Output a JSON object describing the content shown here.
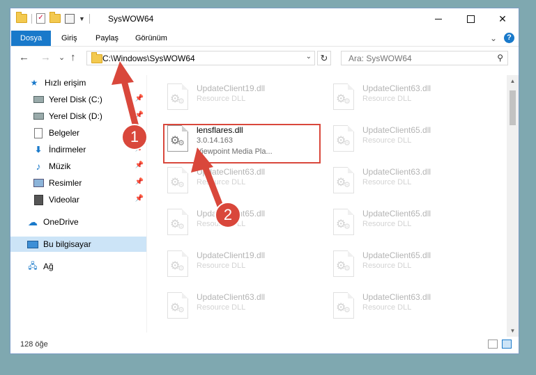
{
  "window": {
    "title": "SysWOW64",
    "controls": {
      "minimize": "—",
      "maximize": "",
      "close": "✕"
    }
  },
  "ribbon": {
    "tabs": [
      "Dosya",
      "Giriş",
      "Paylaş",
      "Görünüm"
    ],
    "expand_glyph": "⌄",
    "help": "?"
  },
  "nav": {
    "back": "←",
    "forward": "→",
    "recent": "⌄",
    "up": "↑",
    "address": "C:\\Windows\\SysWOW64",
    "address_dropdown": "⌄",
    "refresh": "↻",
    "search_placeholder": "Ara: SysWOW64",
    "search_glyph": "⚲"
  },
  "sidebar": {
    "quick_access": "Hızlı erişim",
    "items": [
      {
        "label": "Yerel Disk (C:)",
        "icon": "drive-icon",
        "pinned": true
      },
      {
        "label": "Yerel Disk (D:)",
        "icon": "drive-icon",
        "pinned": true
      },
      {
        "label": "Belgeler",
        "icon": "documents-icon",
        "pinned": true
      },
      {
        "label": "İndirmeler",
        "icon": "downloads-icon",
        "pinned": true
      },
      {
        "label": "Müzik",
        "icon": "music-icon",
        "pinned": true
      },
      {
        "label": "Resimler",
        "icon": "pictures-icon",
        "pinned": true
      },
      {
        "label": "Videolar",
        "icon": "videos-icon",
        "pinned": true
      }
    ],
    "onedrive": "OneDrive",
    "this_pc": "Bu bilgisayar",
    "network": "Ağ",
    "pin_glyph": "📌"
  },
  "files": {
    "left_column": [
      {
        "name": "UpdateClient19.dll",
        "sub1": "Resource DLL",
        "sub2": "",
        "faded": true
      },
      {
        "name": "lensflares.dll",
        "sub1": "3.0.14.163",
        "sub2": "Viewpoint Media Pla...",
        "faded": false,
        "highlighted": true
      },
      {
        "name": "UpdateClient63.dll",
        "sub1": "Resource DLL",
        "sub2": "",
        "faded": true
      },
      {
        "name": "UpdateClient65.dll",
        "sub1": "Resource DLL",
        "sub2": "",
        "faded": true
      },
      {
        "name": "UpdateClient19.dll",
        "sub1": "Resource DLL",
        "sub2": "",
        "faded": true
      },
      {
        "name": "UpdateClient63.dll",
        "sub1": "Resource DLL",
        "sub2": "",
        "faded": true
      }
    ],
    "right_column": [
      {
        "name": "UpdateClient63.dll",
        "sub1": "Resource DLL"
      },
      {
        "name": "UpdateClient65.dll",
        "sub1": "Resource DLL"
      },
      {
        "name": "UpdateClient63.dll",
        "sub1": "Resource DLL"
      },
      {
        "name": "UpdateClient65.dll",
        "sub1": "Resource DLL"
      },
      {
        "name": "UpdateClient65.dll",
        "sub1": "Resource DLL"
      },
      {
        "name": "UpdateClient63.dll",
        "sub1": "Resource DLL"
      }
    ]
  },
  "status": {
    "count": "128 öğe"
  },
  "annotations": {
    "step1": "1",
    "step2": "2"
  },
  "colors": {
    "accent": "#1979ca",
    "highlight": "#d9473b"
  }
}
